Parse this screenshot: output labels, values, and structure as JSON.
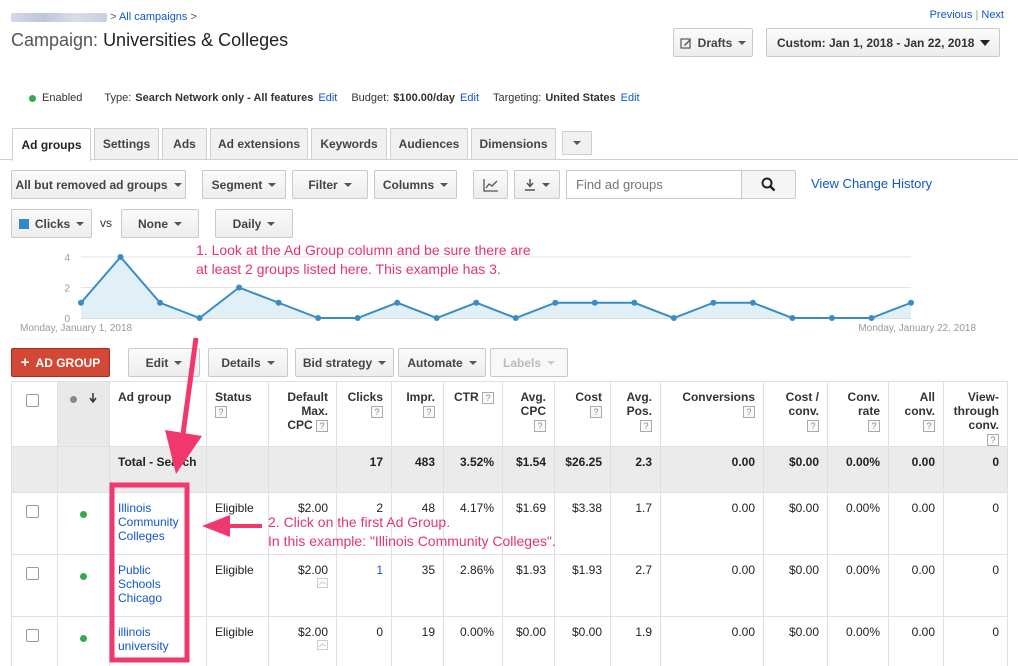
{
  "header": {
    "breadcrumb_link": "All campaigns",
    "campaign_prefix": "Campaign:",
    "campaign_name": "Universities & Colleges",
    "previous": "Previous",
    "next": "Next",
    "separator": "|",
    "drafts": "Drafts",
    "date_range": "Custom: Jan 1, 2018 - Jan 22, 2018"
  },
  "settings": {
    "status": "Enabled",
    "type_label": "Type:",
    "type_value": "Search Network only - All features",
    "budget_label": "Budget:",
    "budget_value": "$100.00/day",
    "targeting_label": "Targeting:",
    "targeting_value": "United States",
    "edit": "Edit"
  },
  "tabs": [
    "Ad groups",
    "Settings",
    "Ads",
    "Ad extensions",
    "Keywords",
    "Audiences",
    "Dimensions"
  ],
  "toolbar": {
    "filter_dropdown": "All but removed ad groups",
    "segment": "Segment",
    "filter": "Filter",
    "columns": "Columns",
    "search_placeholder": "Find ad groups",
    "view_history": "View Change History"
  },
  "chart_controls": {
    "metric1": "Clicks",
    "vs": "vs",
    "metric2": "None",
    "interval": "Daily"
  },
  "chart_data": {
    "type": "area",
    "series": [
      {
        "name": "Clicks",
        "values": [
          1,
          4,
          1,
          0,
          2,
          1,
          0,
          0,
          1,
          0,
          1,
          0,
          1,
          1,
          1,
          0,
          1,
          1,
          0,
          0,
          0,
          1
        ]
      }
    ],
    "yticks": [
      0,
      2,
      4
    ],
    "ylim": [
      0,
      4
    ],
    "x_start_label": "Monday, January 1, 2018",
    "x_end_label": "Monday, January 22, 2018",
    "grid": true,
    "color": "#3a8cc4"
  },
  "actions": {
    "add_group": "AD GROUP",
    "edit": "Edit",
    "details": "Details",
    "bid_strategy": "Bid strategy",
    "automate": "Automate",
    "labels": "Labels"
  },
  "table": {
    "headers": [
      "Ad group",
      "Status",
      "Default Max. CPC",
      "Clicks",
      "Impr.",
      "CTR",
      "Avg. CPC",
      "Cost",
      "Avg. Pos.",
      "Conversions",
      "Cost / conv.",
      "Conv. rate",
      "All conv.",
      "View-through conv."
    ],
    "help": "?",
    "total": {
      "label": "Total - Search",
      "clicks": "17",
      "impr": "483",
      "ctr": "3.52%",
      "avg_cpc": "$1.54",
      "cost": "$26.25",
      "avg_pos": "2.3",
      "conversions": "0.00",
      "cost_conv": "$0.00",
      "conv_rate": "0.00%",
      "all_conv": "0.00",
      "view_through": "0"
    },
    "rows": [
      {
        "name": "Illinois Community Colleges",
        "status": "Eligible",
        "cpc": "$2.00",
        "clicks": "2",
        "impr": "48",
        "ctr": "4.17%",
        "avg_cpc": "$1.69",
        "cost": "$3.38",
        "avg_pos": "1.7",
        "conversions": "0.00",
        "cost_conv": "$0.00",
        "conv_rate": "0.00%",
        "all_conv": "0.00",
        "view_through": "0"
      },
      {
        "name": "Public Schools Chicago",
        "status": "Eligible",
        "cpc": "$2.00",
        "clicks": "1",
        "impr": "35",
        "ctr": "2.86%",
        "avg_cpc": "$1.93",
        "cost": "$1.93",
        "avg_pos": "2.7",
        "conversions": "0.00",
        "cost_conv": "$0.00",
        "conv_rate": "0.00%",
        "all_conv": "0.00",
        "view_through": "0"
      },
      {
        "name": "illinois university",
        "status": "Eligible",
        "cpc": "$2.00",
        "clicks": "0",
        "impr": "19",
        "ctr": "0.00%",
        "avg_cpc": "$0.00",
        "cost": "$0.00",
        "avg_pos": "1.9",
        "conversions": "0.00",
        "cost_conv": "$0.00",
        "conv_rate": "0.00%",
        "all_conv": "0.00",
        "view_through": "0"
      }
    ]
  },
  "annotations": {
    "note1_line1": "1.  Look at the Ad Group column and be sure there are",
    "note1_line2": "at least 2 groups listed here.  This example has 3.",
    "note2_line1": "2. Click on the first Ad Group.",
    "note2_line2": "In this example: \"Illinois Community Colleges\"."
  }
}
